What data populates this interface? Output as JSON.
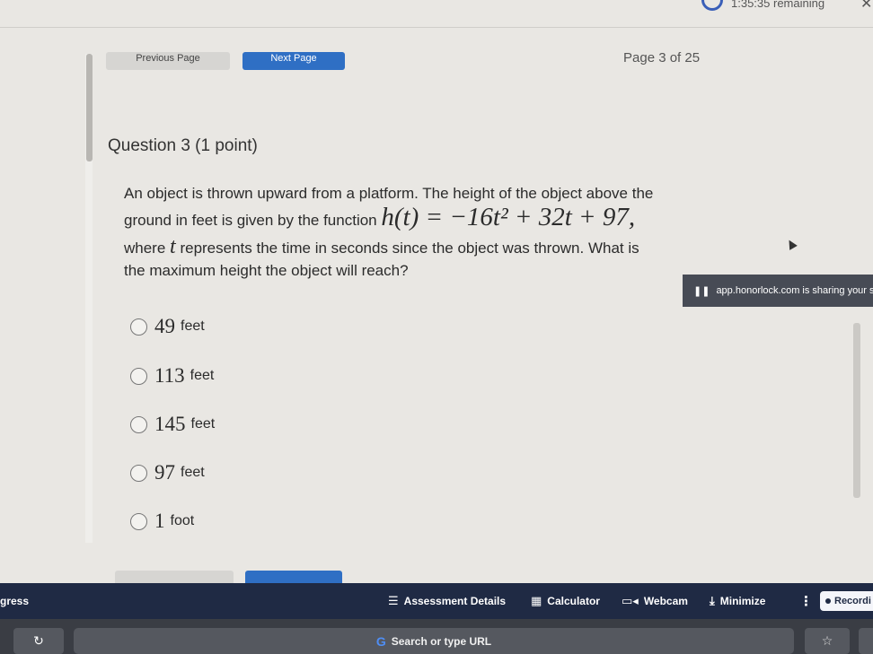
{
  "timer": {
    "text": "1:35:35 remaining"
  },
  "nav": {
    "previous_label": "Previous Page",
    "next_label": "Next Page",
    "page_indicator": "Page 3 of 25"
  },
  "question": {
    "title": "Question 3 (1 point)",
    "line1": "An object is thrown upward from a platform. The height of the object above the",
    "line2_text": "ground in feet is given by the function",
    "equation": "h(t) = −16t² + 32t + 97,",
    "line3_prefix": "where",
    "line3_var": "t",
    "line3_suffix": "represents the time in seconds since the object was thrown. What is",
    "line4": "the maximum height the object will reach?"
  },
  "options": [
    {
      "value": "49",
      "unit": "feet"
    },
    {
      "value": "113",
      "unit": "feet"
    },
    {
      "value": "145",
      "unit": "feet"
    },
    {
      "value": "97",
      "unit": "feet"
    },
    {
      "value": "1",
      "unit": "foot"
    }
  ],
  "share_banner": {
    "text": "app.honorlock.com is sharing your sc"
  },
  "proctor_bar": {
    "progress_label": "gress",
    "assessment_details": "Assessment Details",
    "calculator": "Calculator",
    "webcam": "Webcam",
    "minimize": "Minimize",
    "recording": "Recordi"
  },
  "browser": {
    "url_placeholder": "Search or type URL"
  },
  "icons": {
    "list": "list-icon",
    "calculator": "calculator-icon",
    "webcam": "webcam-icon",
    "minimize": "download-icon",
    "more": "more-vertical-icon",
    "reload": "reload-icon",
    "google": "google-icon",
    "star": "star-icon",
    "close": "close-icon",
    "timer": "timer-ring-icon",
    "pause": "pause-icon"
  },
  "colors": {
    "accent": "#2f6fc4",
    "proctor_bar": "#1f2a44",
    "banner": "#474b55"
  }
}
